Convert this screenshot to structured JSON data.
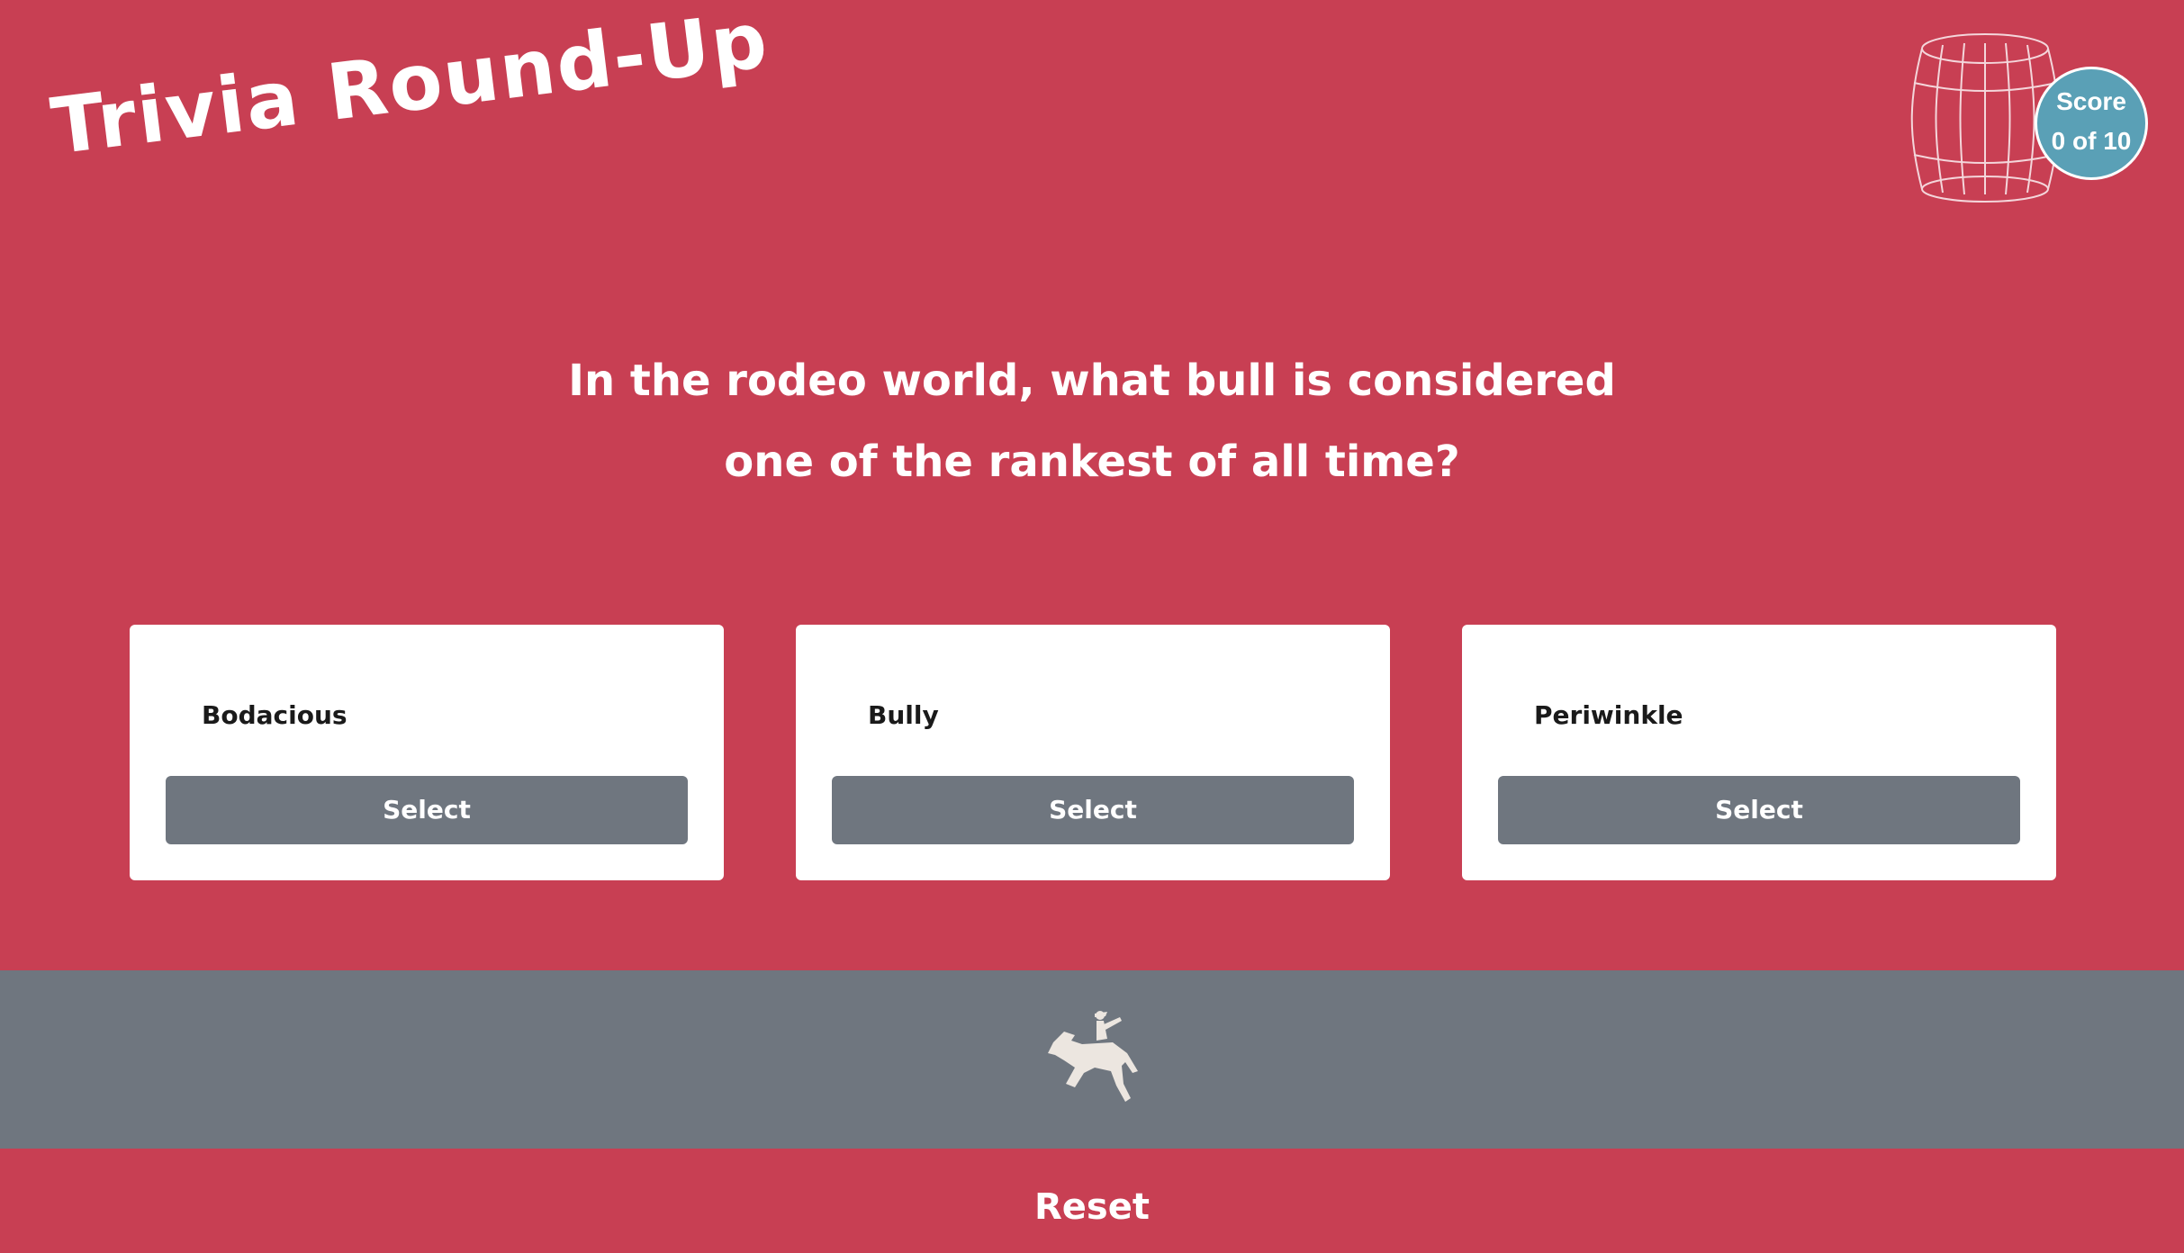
{
  "header": {
    "title": "Trivia Round-Up"
  },
  "score": {
    "label": "Score",
    "value": "0 of 10"
  },
  "question": {
    "line1": "In the rodeo world, what bull is considered",
    "line2": "one of the rankest of all time?"
  },
  "answers": [
    {
      "text": "Bodacious",
      "button": "Select"
    },
    {
      "text": "Bully",
      "button": "Select"
    },
    {
      "text": "Periwinkle",
      "button": "Select"
    }
  ],
  "footer": {
    "icon": "bucking-horse-rider-icon",
    "reset_label": "Reset"
  },
  "colors": {
    "background": "#c83f53",
    "button": "#6f767f",
    "score_badge": "#5aa0b6",
    "card": "#ffffff"
  }
}
